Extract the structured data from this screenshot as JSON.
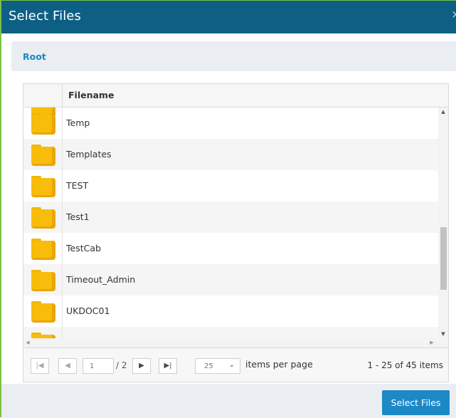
{
  "dialog": {
    "title": "Select Files",
    "close_glyph": "×"
  },
  "breadcrumb": {
    "root": "Root"
  },
  "grid": {
    "column_header": "Filename",
    "rows": [
      {
        "name": "Temp",
        "icon": "folder-icon"
      },
      {
        "name": "Templates",
        "icon": "folder-icon"
      },
      {
        "name": "TEST",
        "icon": "folder-icon"
      },
      {
        "name": "Test1",
        "icon": "folder-icon"
      },
      {
        "name": "TestCab",
        "icon": "folder-icon"
      },
      {
        "name": "Timeout_Admin",
        "icon": "folder-icon"
      },
      {
        "name": "UKDOC01",
        "icon": "folder-icon"
      }
    ]
  },
  "pager": {
    "first_glyph": "|◀",
    "prev_glyph": "◀",
    "next_glyph": "▶",
    "last_glyph": "▶|",
    "current_page": "1",
    "total_pages_label": "/ 2",
    "per_page_value": "25",
    "per_page_chevron": "⌄",
    "per_page_label": "items per page",
    "items_info": "1 - 25 of 45 items"
  },
  "footer": {
    "select_button": "Select Files"
  },
  "colors": {
    "titlebar": "#0d5f84",
    "accent": "#1d88c6",
    "folder": "#f8bd0b",
    "border_green": "#7cc242"
  }
}
